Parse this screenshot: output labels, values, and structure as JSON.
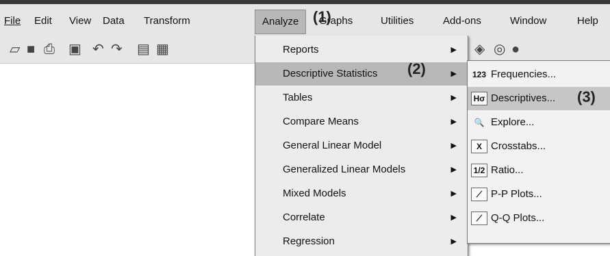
{
  "menubar": {
    "items": [
      {
        "label": "File"
      },
      {
        "label": "Edit"
      },
      {
        "label": "View"
      },
      {
        "label": "Data"
      },
      {
        "label": "Transform"
      },
      {
        "label": "Analyze"
      },
      {
        "label": "Graphs"
      },
      {
        "label": "Utilities"
      },
      {
        "label": "Add-ons"
      },
      {
        "label": "Window"
      },
      {
        "label": "Help"
      }
    ]
  },
  "toolbar": {
    "icons": [
      "open-folder-icon",
      "save-icon",
      "print-icon",
      "dialog-recall-icon",
      "undo-icon",
      "redo-icon",
      "goto-case-icon",
      "goto-variable-icon",
      "value-labels-icon",
      "use-sets-icon",
      "show-all-icon"
    ]
  },
  "callouts": [
    "(1)",
    "(2)",
    "(3)"
  ],
  "analyze_menu": {
    "items": [
      {
        "label": "Reports",
        "has_submenu": true
      },
      {
        "label": "Descriptive Statistics",
        "has_submenu": true
      },
      {
        "label": "Tables",
        "has_submenu": true
      },
      {
        "label": "Compare Means",
        "has_submenu": true
      },
      {
        "label": "General Linear Model",
        "has_submenu": true
      },
      {
        "label": "Generalized Linear Models",
        "has_submenu": true
      },
      {
        "label": "Mixed Models",
        "has_submenu": true
      },
      {
        "label": "Correlate",
        "has_submenu": true
      },
      {
        "label": "Regression",
        "has_submenu": true
      }
    ]
  },
  "descriptive_submenu": {
    "items": [
      {
        "label": "Frequencies...",
        "icon": "123"
      },
      {
        "label": "Descriptives...",
        "icon": "Hσ"
      },
      {
        "label": "Explore...",
        "icon": "explore"
      },
      {
        "label": "Crosstabs...",
        "icon": "X"
      },
      {
        "label": "Ratio...",
        "icon": "1/2"
      },
      {
        "label": "P-P Plots...",
        "icon": "pp-plot"
      },
      {
        "label": "Q-Q Plots...",
        "icon": "qq-plot"
      }
    ]
  },
  "arrow_glyph": "▶",
  "colors": {
    "highlight": "#b8b8b8",
    "menu_bg": "#ececec",
    "bar_bg": "#e6e6e6"
  }
}
